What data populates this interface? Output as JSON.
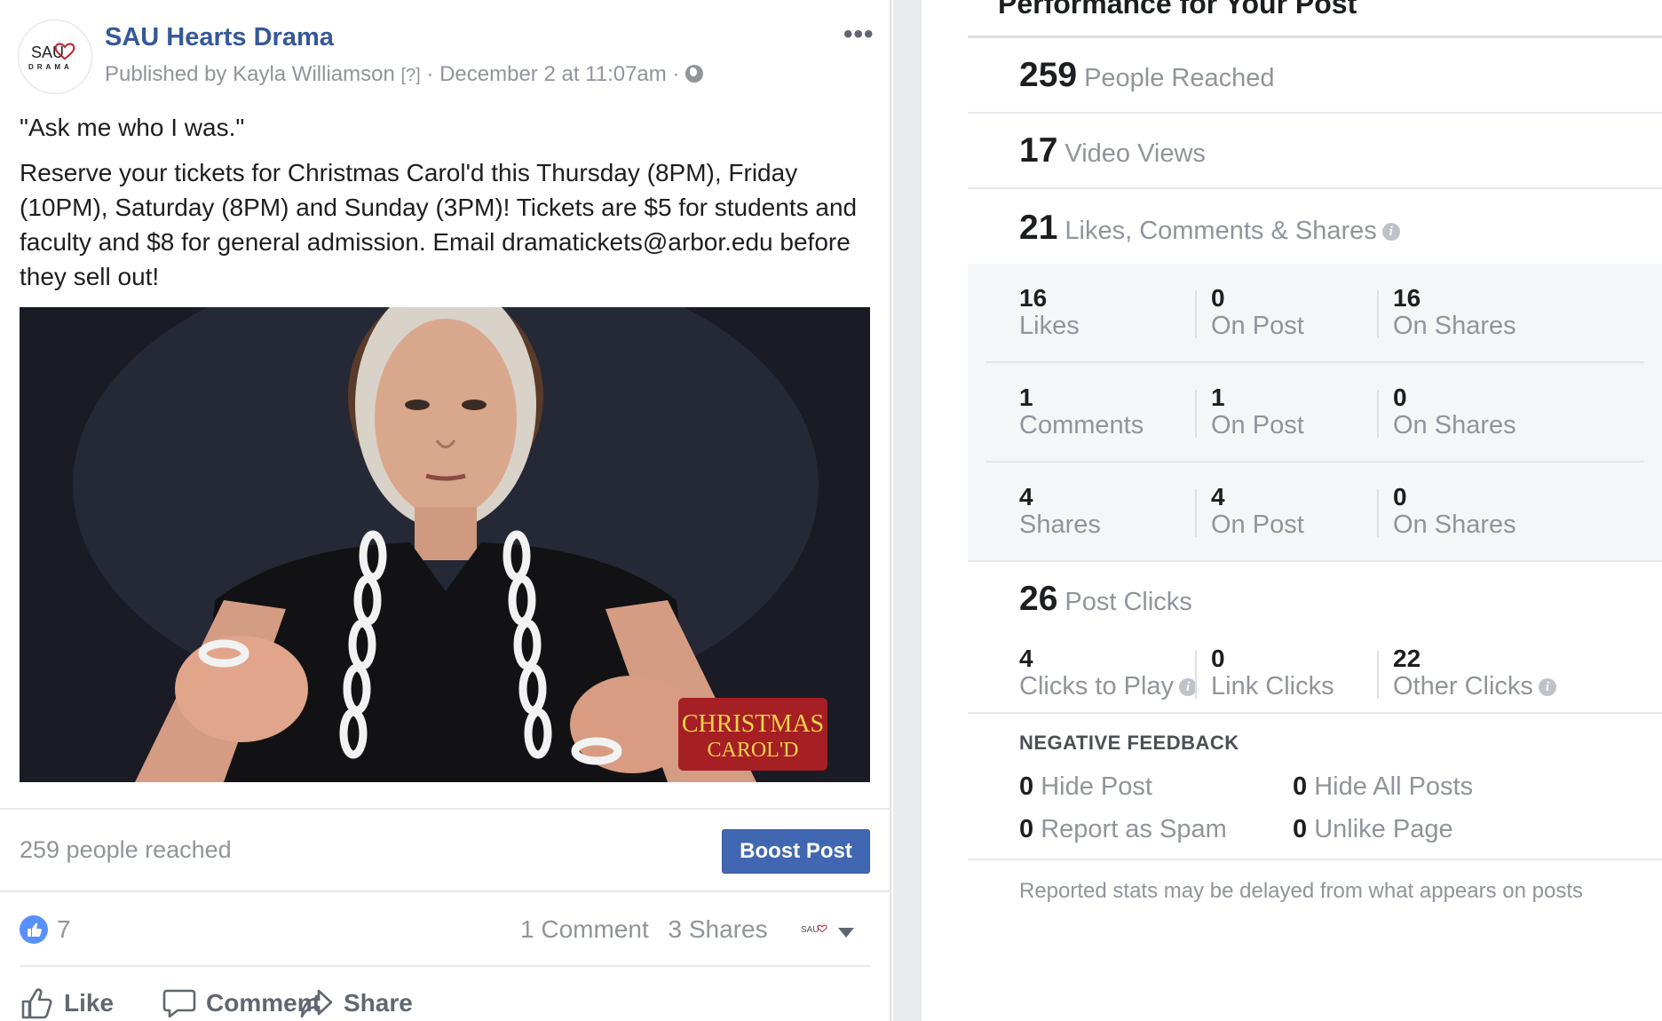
{
  "post": {
    "page_name": "SAU Hearts Drama",
    "avatar_text_top": "SAU",
    "avatar_text_bottom": "DRAMA",
    "published_by": "Published by Kayla Williamson",
    "help_marker": "[?]",
    "separator": "·",
    "timestamp": "December 2 at 11:07am",
    "more_label": "•••",
    "quote_line": "\"Ask me who I was.\"",
    "body_text": "Reserve your tickets for Christmas Carol'd this Thursday (8PM), Friday (10PM), Saturday (8PM) and Sunday (3PM)! Tickets are $5 for students and faculty and $8 for general admission. Email dramatickets@arbor.edu before they sell out!",
    "video_watermark_line1": "CHRISTMAS",
    "video_watermark_line2": "CAROL'D",
    "reach_text": "259 people reached",
    "boost_label": "Boost Post",
    "like_count": "7",
    "comment_count": "1 Comment",
    "share_count": "3 Shares",
    "actions": {
      "like": "Like",
      "comment": "Comment",
      "share": "Share"
    }
  },
  "performance": {
    "title": "Performance for Your Post",
    "people_reached": {
      "value": "259",
      "label": "People Reached"
    },
    "video_views": {
      "value": "17",
      "label": "Video Views"
    },
    "engagement": {
      "value": "21",
      "label": "Likes, Comments & Shares"
    },
    "breakdown": [
      {
        "total": "16",
        "total_label": "Likes",
        "on_post": "0",
        "on_post_label": "On Post",
        "on_shares": "16",
        "on_shares_label": "On Shares"
      },
      {
        "total": "1",
        "total_label": "Comments",
        "on_post": "1",
        "on_post_label": "On Post",
        "on_shares": "0",
        "on_shares_label": "On Shares"
      },
      {
        "total": "4",
        "total_label": "Shares",
        "on_post": "4",
        "on_post_label": "On Post",
        "on_shares": "0",
        "on_shares_label": "On Shares"
      }
    ],
    "post_clicks": {
      "value": "26",
      "label": "Post Clicks",
      "clicks_to_play": "4",
      "clicks_to_play_label": "Clicks to Play",
      "link_clicks": "0",
      "link_clicks_label": "Link Clicks",
      "other_clicks": "22",
      "other_clicks_label": "Other Clicks"
    },
    "negative_feedback": {
      "heading": "NEGATIVE FEEDBACK",
      "hide_post": "0",
      "hide_post_label": "Hide Post",
      "hide_all": "0",
      "hide_all_label": "Hide All Posts",
      "report_spam": "0",
      "report_spam_label": "Report as Spam",
      "unlike_page": "0",
      "unlike_page_label": "Unlike Page"
    },
    "footnote": "Reported stats may be delayed from what appears on posts",
    "info_glyph": "i"
  },
  "colors": {
    "link_blue": "#365899",
    "boost_blue": "#4267b2",
    "like_blue": "#5890ff",
    "muted": "#90949c"
  }
}
